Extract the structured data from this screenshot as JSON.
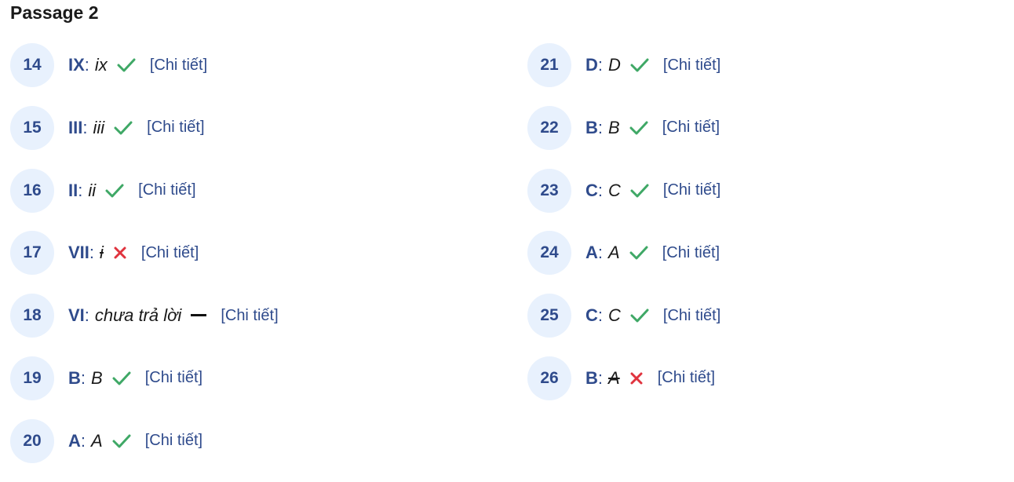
{
  "title": "Passage 2",
  "colors": {
    "accent": "#2f4b8c",
    "badge_bg": "#e8f1fd",
    "correct": "#3fa866",
    "wrong": "#e0333e",
    "skip": "#111111"
  },
  "left": [
    {
      "num": "14",
      "key": "IX",
      "ans": "ix",
      "status": "correct",
      "detail": "[Chi tiết]"
    },
    {
      "num": "15",
      "key": "III",
      "ans": "iii",
      "status": "correct",
      "detail": "[Chi tiết]"
    },
    {
      "num": "16",
      "key": "II",
      "ans": "ii",
      "status": "correct",
      "detail": "[Chi tiết]"
    },
    {
      "num": "17",
      "key": "VII",
      "ans": "i",
      "status": "wrong",
      "detail": "[Chi tiết]"
    },
    {
      "num": "18",
      "key": "VI",
      "ans": "chưa trả lời",
      "status": "unanswered",
      "detail": "[Chi tiết]"
    },
    {
      "num": "19",
      "key": "B",
      "ans": "B",
      "status": "correct",
      "detail": "[Chi tiết]"
    },
    {
      "num": "20",
      "key": "A",
      "ans": "A",
      "status": "correct",
      "detail": "[Chi tiết]"
    }
  ],
  "right": [
    {
      "num": "21",
      "key": "D",
      "ans": "D",
      "status": "correct",
      "detail": "[Chi tiết]"
    },
    {
      "num": "22",
      "key": "B",
      "ans": "B",
      "status": "correct",
      "detail": "[Chi tiết]"
    },
    {
      "num": "23",
      "key": "C",
      "ans": "C",
      "status": "correct",
      "detail": "[Chi tiết]"
    },
    {
      "num": "24",
      "key": "A",
      "ans": "A",
      "status": "correct",
      "detail": "[Chi tiết]"
    },
    {
      "num": "25",
      "key": "C",
      "ans": "C",
      "status": "correct",
      "detail": "[Chi tiết]"
    },
    {
      "num": "26",
      "key": "B",
      "ans": "A",
      "status": "wrong",
      "detail": "[Chi tiết]"
    }
  ]
}
